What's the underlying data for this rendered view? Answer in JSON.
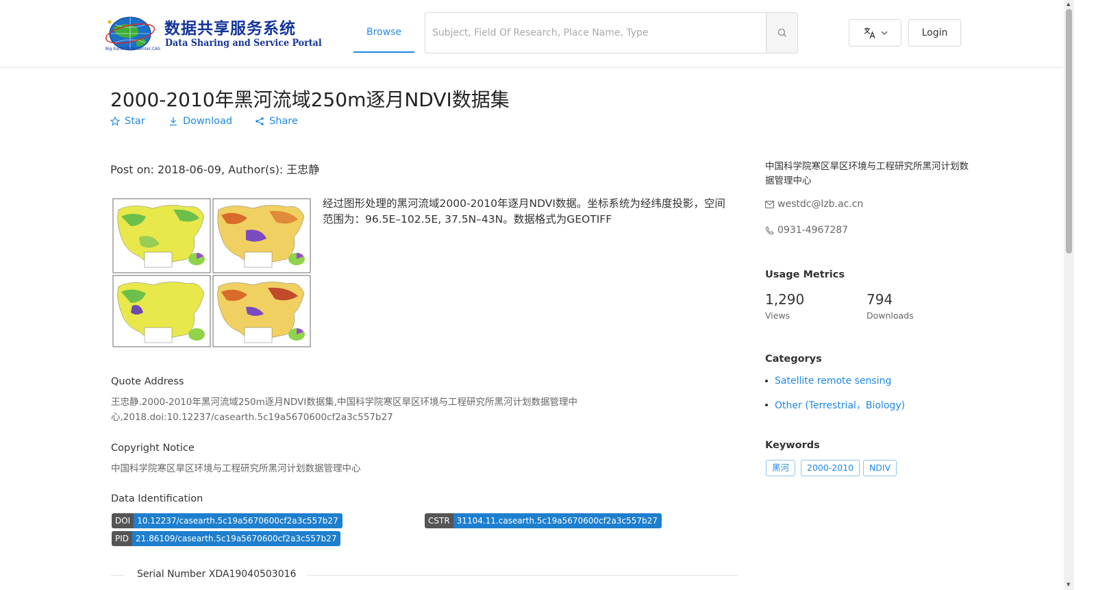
{
  "header": {
    "logo_cn": "数据共享服务系统",
    "logo_en": "Data Sharing and Service Portal",
    "logo_sub": "Big Earth Data Center,CAS",
    "nav_browse": "Browse",
    "search_placeholder": "Subject, Field Of Research, Place Name, Type",
    "search_value": "",
    "login_label": "Login"
  },
  "dataset": {
    "title": "2000-2010年黑河流域250m逐月NDVI数据集",
    "actions": {
      "star": "Star",
      "download": "Download",
      "share": "Share"
    },
    "post_on": "Post on: 2018-06-09, Author(s): 王忠静",
    "description": "经过图形处理的黑河流域2000-2010年逐月NDVI数据。坐标系统为经纬度投影，空间范围为：96.5E–102.5E, 37.5N–43N。数据格式为GEOTIFF",
    "quote_label": "Quote Address",
    "quote_text": "王忠静.2000-2010年黑河流域250m逐月NDVI数据集,中国科学院寒区旱区环境与工程研究所黑河计划数据管理中心,2018.doi:10.12237/casearth.5c19a5670600cf2a3c557b27",
    "copyright_label": "Copyright Notice",
    "copyright_text": "中国科学院寒区旱区环境与工程研究所黑河计划数据管理中心",
    "ident_label": "Data Identification",
    "doi_key": "DOI",
    "doi_value": "10.12237/casearth.5c19a5670600cf2a3c557b27",
    "cstr_key": "CSTR",
    "cstr_value": "31104.11.casearth.5c19a5670600cf2a3c557b27",
    "pid_key": "PID",
    "pid_value": "21.86109/casearth.5c19a5670600cf2a3c557b27",
    "serial": "Serial Number XDA19040503016"
  },
  "sidebar": {
    "org": "中国科学院寒区旱区环境与工程研究所黑河计划数据管理中心",
    "email": "westdc@lzb.ac.cn",
    "phone": "0931-4967287",
    "metrics_heading": "Usage Metrics",
    "views_value": "1,290",
    "views_label": "Views",
    "downloads_value": "794",
    "downloads_label": "Downloads",
    "categories_heading": "Categorys",
    "categories": [
      "Satellite remote sensing",
      "Other (Terrestrial，Biology)"
    ],
    "keywords_heading": "Keywords",
    "keywords": [
      "黑河",
      "2000-2010",
      "NDIV"
    ]
  },
  "colors": {
    "accent": "#1e88e5",
    "brand": "#14349a",
    "badge_key": "#555555",
    "badge_value": "#1e7fce"
  },
  "icons": [
    "globe-logo-icon",
    "search-icon",
    "translate-icon",
    "chevron-down-icon",
    "star-icon",
    "download-icon",
    "share-icon",
    "mail-icon",
    "phone-icon"
  ]
}
